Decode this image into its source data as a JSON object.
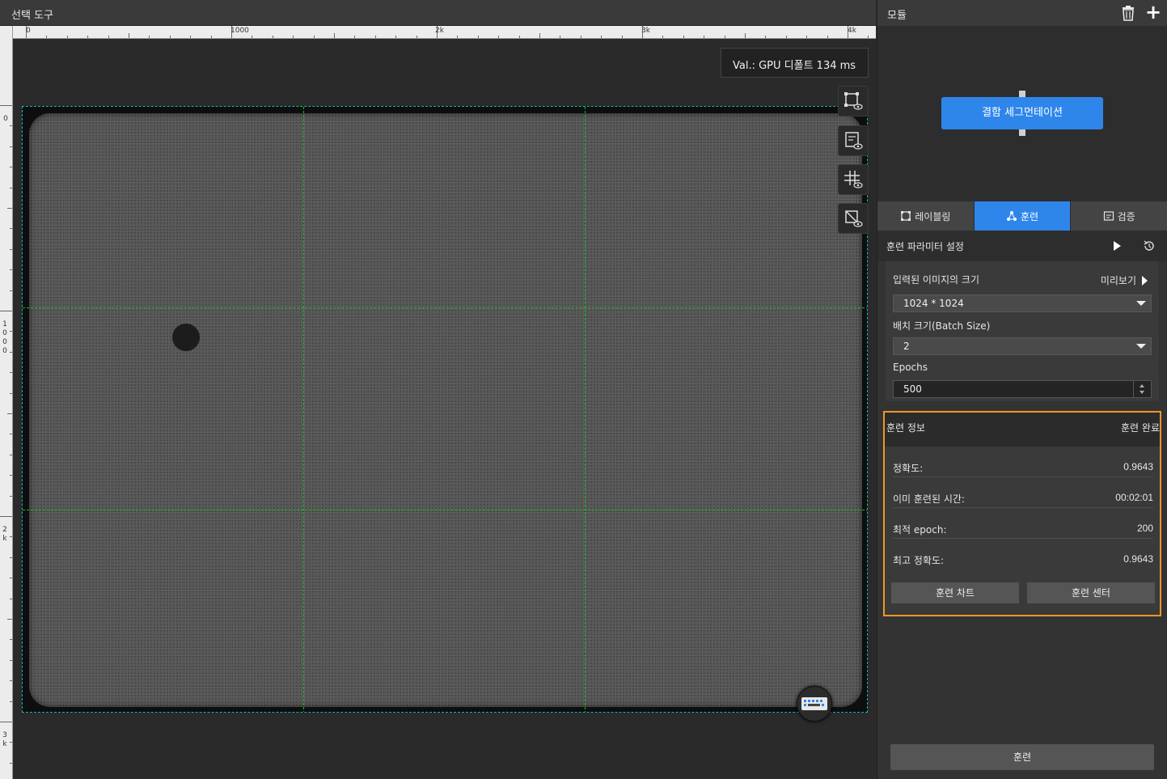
{
  "left_panel": {
    "title": "선택 도구",
    "ruler_h": [
      "0",
      "1000",
      "2k",
      "3k",
      "4k"
    ],
    "ruler_v": [
      "0",
      "1000",
      "2k",
      "3k"
    ],
    "val_info": "Val.:  GPU 디폴트 134 ms",
    "tools": [
      "roi-view-icon",
      "annotation-view-icon",
      "grid-view-icon",
      "mask-view-icon"
    ],
    "keyboard_icon": "keyboard-icon"
  },
  "right_panel": {
    "title": "모듈",
    "module_node": "결함 세그먼테이션",
    "tabs": [
      {
        "label": "레이블링",
        "icon": "labeling-icon"
      },
      {
        "label": "훈련",
        "icon": "training-icon"
      },
      {
        "label": "검증",
        "icon": "validation-icon"
      }
    ],
    "active_tab": "훈련",
    "params": {
      "section_title": "훈련 파라미터 설정",
      "image_size_label": "입력된 이미지의 크기",
      "preview_label": "미리보기",
      "image_size_value": "1024 * 1024",
      "batch_label": "배치 크기(Batch Size)",
      "batch_value": "2",
      "epochs_label": "Epochs",
      "epochs_value": "500"
    },
    "train_info": {
      "title": "훈련 정보",
      "status": "훈련 완료",
      "rows": [
        {
          "key": "정확도:",
          "value": "0.9643"
        },
        {
          "key": "이미 훈련된 시간:",
          "value": "00:02:01"
        },
        {
          "key": "최적 epoch:",
          "value": "200"
        },
        {
          "key": "최고 정확도:",
          "value": "0.9643"
        }
      ],
      "chart_button": "훈련 차트",
      "center_button": "훈련 센터"
    },
    "train_button": "훈련",
    "colors": {
      "accent": "#2f86ea",
      "highlight": "#f0962a",
      "grid": "#1bbf1b",
      "roi": "#18b6b6"
    }
  }
}
